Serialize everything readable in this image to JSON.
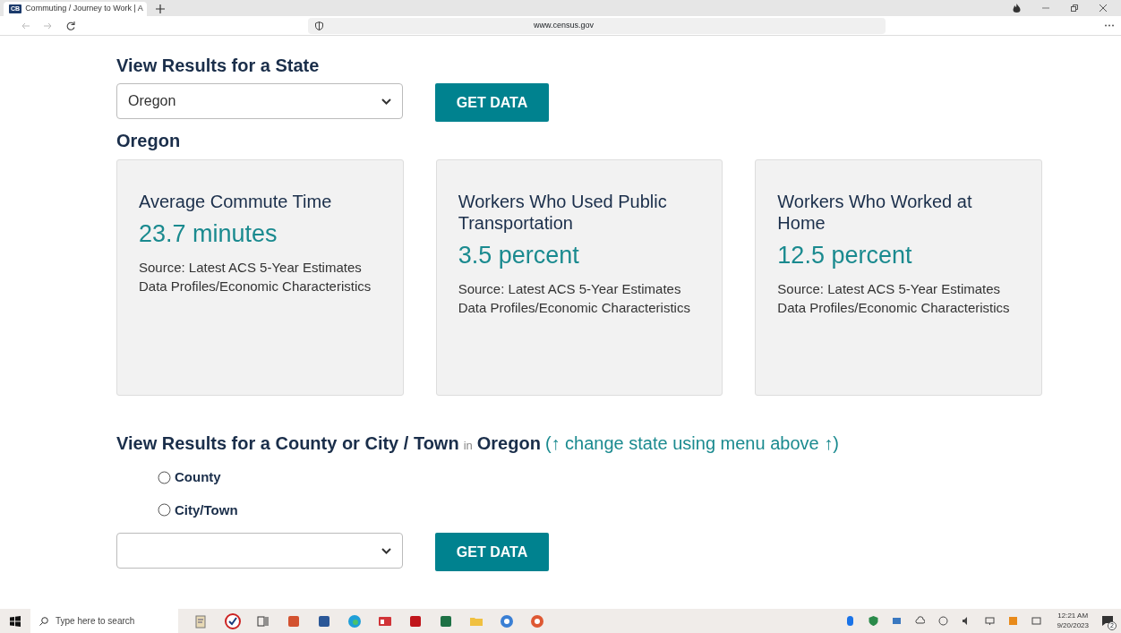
{
  "browser": {
    "tab": {
      "favicon": "CB",
      "title": "Commuting / Journey to Work | A",
      "selected": true
    },
    "url": "www.census.gov"
  },
  "state_section": {
    "heading": "View Results for a State",
    "select": {
      "value": "Oregon"
    },
    "button": "GET DATA"
  },
  "result": {
    "title": "Oregon",
    "cards": [
      {
        "title": "Average Commute Time",
        "value": "23.7 minutes",
        "source": "Source: Latest ACS 5-Year Estimates Data Profiles/Economic Characteristics"
      },
      {
        "title": "Workers Who Used Public Transportation",
        "value": "3.5 percent",
        "source": "Source: Latest ACS 5-Year Estimates Data Profiles/Economic Characteristics"
      },
      {
        "title": "Workers Who Worked at Home",
        "value": "12.5 percent",
        "source": "Source: Latest ACS 5-Year Estimates Data Profiles/Economic Characteristics"
      }
    ]
  },
  "county_section": {
    "heading": "View Results for a County or City / Town",
    "connector": "in",
    "state": "Oregon",
    "hint": "(↑ change state using menu above ↑)",
    "options": [
      {
        "label": "County",
        "selected": false
      },
      {
        "label": "City/Town",
        "selected": false
      }
    ],
    "button": "GET DATA"
  },
  "taskbar": {
    "search": {
      "placeholder": "Type here to search"
    },
    "time": "12:21 AM",
    "date": "9/20/2023",
    "notifications": "2"
  }
}
